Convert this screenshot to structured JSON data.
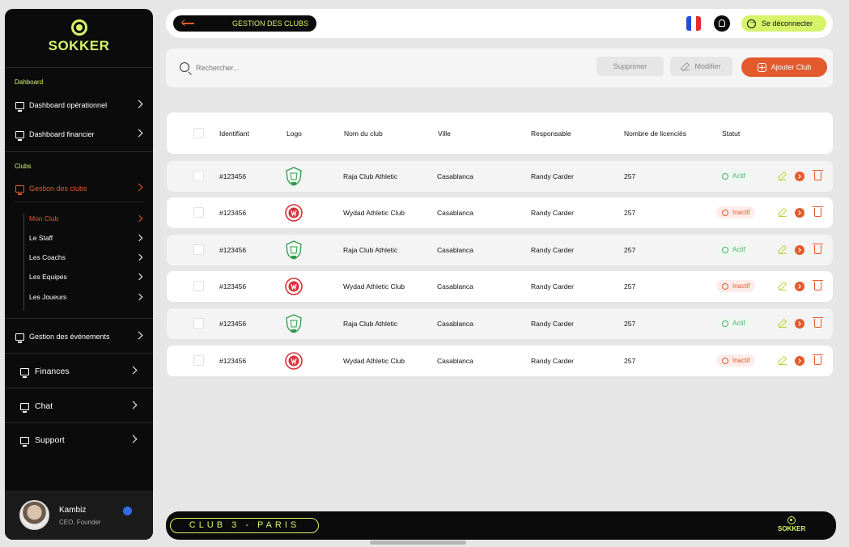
{
  "brand": {
    "name": "SOKKER",
    "color": "#d7f36a",
    "accent": "#e35a2c"
  },
  "sidebar": {
    "sections": [
      {
        "label": "Dahboard"
      },
      {
        "label": "Clubs"
      }
    ],
    "items": [
      {
        "label": "Dashboard opérationnel",
        "icon": "presentation-icon"
      },
      {
        "label": "Dashboard financier",
        "icon": "presentation-icon"
      },
      {
        "label": "Gestion des clubs",
        "icon": "presentation-icon",
        "active": true
      },
      {
        "label": "Gestion des événements",
        "icon": "presentation-icon"
      },
      {
        "label": "Finances",
        "icon": "presentation-icon"
      },
      {
        "label": "Chat",
        "icon": "presentation-icon"
      },
      {
        "label": "Support",
        "icon": "presentation-icon"
      }
    ],
    "subitems": [
      {
        "label": "Mon Club",
        "active": true
      },
      {
        "label": "Le Staff"
      },
      {
        "label": "Les Coachs"
      },
      {
        "label": "Les Equipes"
      },
      {
        "label": "Les Joueurs"
      }
    ],
    "profile": {
      "name": "Kambiz",
      "role": "CEO, Founder"
    }
  },
  "topbar": {
    "title": "GESTION DES CLUBS",
    "logout_label": "Se déconnecter",
    "flag": "france-flag-icon"
  },
  "toolbar": {
    "search_placeholder": "Rechercher...",
    "delete_label": "Supprimer",
    "edit_label": "Modifier",
    "add_label": "Ajouter Club"
  },
  "table": {
    "columns": [
      "Identifiant",
      "Logo",
      "Nom du club",
      "Ville",
      "Responsable",
      "Nombre de licenciés",
      "Statut"
    ],
    "rows": [
      {
        "id": "#123456",
        "logo": "raja-logo",
        "name": "Raja Club Athletic",
        "city": "Casablanca",
        "manager": "Randy Carder",
        "licensed": "257",
        "status": "Actif",
        "active": true
      },
      {
        "id": "#123456",
        "logo": "wydad-logo",
        "name": "Wydad Athletic Club",
        "city": "Casablanca",
        "manager": "Randy Carder",
        "licensed": "257",
        "status": "Inactif",
        "active": false
      },
      {
        "id": "#123456",
        "logo": "raja-logo",
        "name": "Raja Club Athletic",
        "city": "Casablanca",
        "manager": "Randy Carder",
        "licensed": "257",
        "status": "Actif",
        "active": true
      },
      {
        "id": "#123456",
        "logo": "wydad-logo",
        "name": "Wydad Athletic Club",
        "city": "Casablanca",
        "manager": "Randy Carder",
        "licensed": "257",
        "status": "Inactif",
        "active": false
      },
      {
        "id": "#123456",
        "logo": "raja-logo",
        "name": "Raja Club Athletic",
        "city": "Casablanca",
        "manager": "Randy Carder",
        "licensed": "257",
        "status": "Actif",
        "active": true
      },
      {
        "id": "#123456",
        "logo": "wydad-logo",
        "name": "Wydad Athletic Club",
        "city": "Casablanca",
        "manager": "Randy Carder",
        "licensed": "257",
        "status": "Inactif",
        "active": false
      }
    ]
  },
  "footer": {
    "club_label": "CLUB 3 - PARIS",
    "logo_text": "SOKKER"
  }
}
